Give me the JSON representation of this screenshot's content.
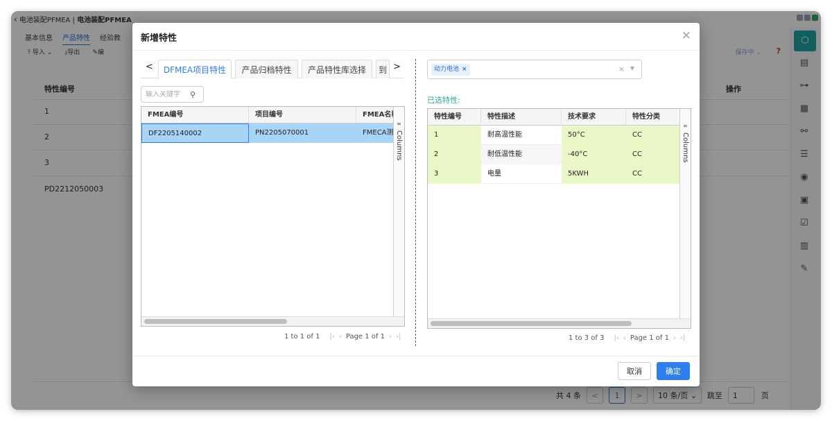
{
  "app": {
    "title_prefix": "电池装配PFMEA | ",
    "title_bold": "电池装配PFMEA",
    "tabs": [
      "基本信息",
      "产品特性",
      "经验教"
    ],
    "active_tab": "产品特性",
    "toolbar": [
      "导入",
      "导出",
      "编"
    ],
    "save_status": "保存中",
    "help": "?",
    "table_header_left": "特性编号",
    "table_header_right": "操作",
    "rows": [
      "1",
      "2",
      "3",
      "PD2212050003"
    ],
    "pager": {
      "total": "共 4 条",
      "prev": "<",
      "page": "1",
      "next": ">",
      "size": "10 条/页",
      "jump_label": "跳至",
      "jump_value": "1",
      "page_suffix": "页"
    }
  },
  "modal": {
    "title": "新增特性",
    "close": "×",
    "cancel": "取消",
    "confirm": "确定",
    "left": {
      "tab_prev": "<",
      "tab_next": ">",
      "tabs": [
        "DFMEA项目特性",
        "产品归档特性",
        "产品特性库选择",
        "到"
      ],
      "active_tab_index": 0,
      "search_placeholder": "输入关键字",
      "columns": [
        "FMEA编号",
        "项目编号",
        "FMEA名称"
      ],
      "rows": [
        [
          "DF2205140002",
          "PN2205070001",
          "FMECA测"
        ]
      ],
      "columns_tool": "Columns",
      "pager": {
        "range": "1 to 1 of 1",
        "page": "Page 1 of 1"
      }
    },
    "right": {
      "chips": [
        "动力电池"
      ],
      "selected_label": "已选特性:",
      "columns": [
        "特性编号",
        "特性描述",
        "技术要求",
        "特性分类"
      ],
      "rows": [
        [
          "1",
          "耐高温性能",
          "50°C",
          "CC"
        ],
        [
          "2",
          "耐低温性能",
          "-40°C",
          "CC"
        ],
        [
          "3",
          "电量",
          "5KWH",
          "CC"
        ]
      ],
      "columns_tool": "Columns",
      "pager": {
        "range": "1 to 3 of 3",
        "page": "Page 1 of 1"
      }
    }
  },
  "colors": {
    "primary": "#2f7ef0",
    "accent_teal": "#2fa6a0",
    "selected_row": "#a8d4f8",
    "highlight_cell": "#eaf8c8"
  }
}
